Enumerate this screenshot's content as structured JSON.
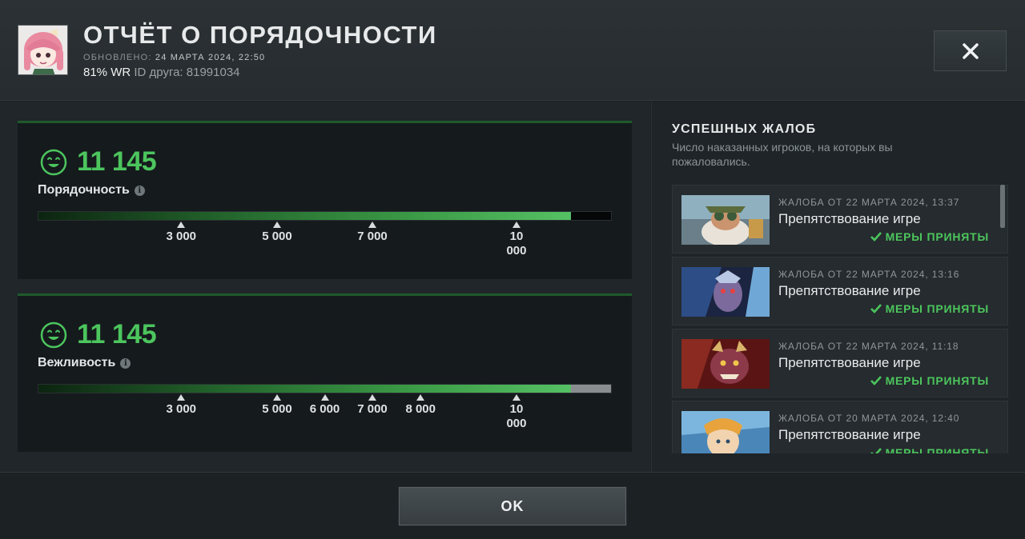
{
  "header": {
    "title": "ОТЧЁТ О ПОРЯДОЧНОСТИ",
    "updated_label": "ОБНОВЛЕНО:",
    "updated_value": "24 МАРТА 2024, 22:50",
    "winrate": "81% WR",
    "friend_id_label": "ID друга:",
    "friend_id": "81991034"
  },
  "cards": [
    {
      "score": "11 145",
      "label": "Порядочность",
      "fill_fraction": 0.93,
      "rest_color": "#050607",
      "ticks": [
        "3 000",
        "5 000",
        "7 000",
        "10 000"
      ]
    },
    {
      "score": "11 145",
      "label": "Вежливость",
      "fill_fraction": 0.93,
      "rest_color": "#8a8d8f",
      "ticks": [
        "3 000",
        "5 000",
        "6 000",
        "7 000",
        "8 000",
        "10 000"
      ]
    }
  ],
  "reports_panel": {
    "title": "УСПЕШНЫХ ЖАЛОБ",
    "description": "Число наказанных игроков, на которых вы пожаловались.",
    "items": [
      {
        "date": "ЖАЛОБА ОТ 22 МАРТА 2024, 13:37",
        "reason": "Препятствование игре",
        "status": "МЕРЫ ПРИНЯТЫ"
      },
      {
        "date": "ЖАЛОБА ОТ 22 МАРТА 2024, 13:16",
        "reason": "Препятствование игре",
        "status": "МЕРЫ ПРИНЯТЫ"
      },
      {
        "date": "ЖАЛОБА ОТ 22 МАРТА 2024, 11:18",
        "reason": "Препятствование игре",
        "status": "МЕРЫ ПРИНЯТЫ"
      },
      {
        "date": "ЖАЛОБА ОТ 20 МАРТА 2024, 12:40",
        "reason": "Препятствование игре",
        "status": "МЕРЫ ПРИНЯТЫ"
      }
    ]
  },
  "footer": {
    "ok_label": "OK"
  },
  "colors": {
    "accent_green": "#4cc55d",
    "background": "#1c2124"
  }
}
